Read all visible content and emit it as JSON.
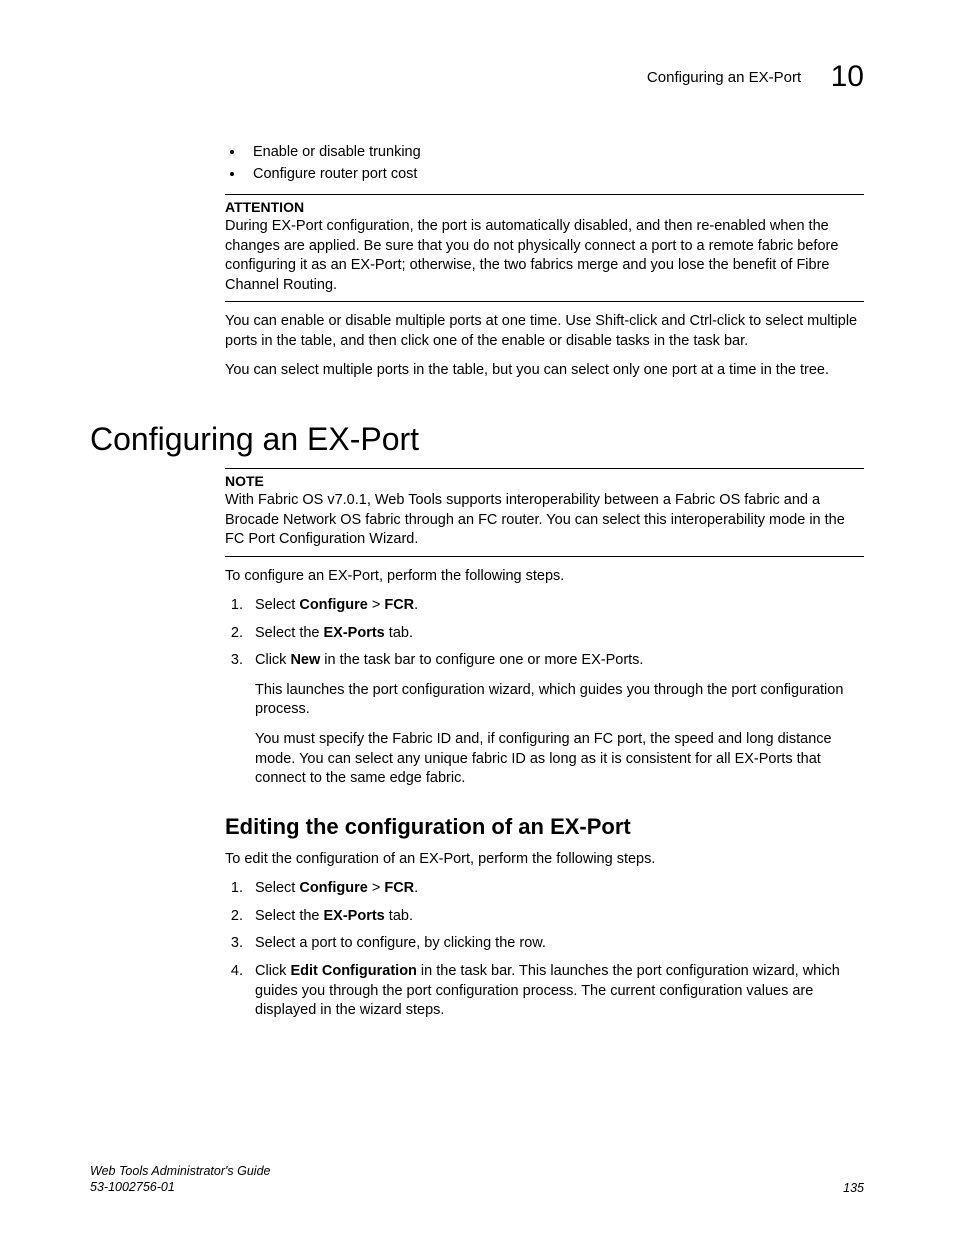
{
  "header": {
    "title": "Configuring an EX-Port",
    "chapter": "10"
  },
  "bullets": [
    "Enable or disable trunking",
    "Configure router port cost"
  ],
  "attention": {
    "label": "ATTENTION",
    "text": "During EX-Port configuration, the port is automatically disabled, and then re-enabled when the changes are applied. Be sure that you do not physically connect a port to a remote fabric before configuring it as an EX-Port; otherwise, the two fabrics merge and you lose the benefit of Fibre Channel Routing."
  },
  "para1": "You can enable or disable multiple ports at one time. Use Shift-click and Ctrl-click to select multiple ports in the table, and then click one of the enable or disable tasks in the task bar.",
  "para2": "You can select multiple ports in the table, but you can select only one port at a time in the tree.",
  "section_heading": "Configuring an EX-Port",
  "note": {
    "label": "NOTE",
    "text": "With Fabric OS v7.0.1, Web Tools supports interoperability between a Fabric OS fabric and a Brocade Network OS fabric through an FC router. You can select this interoperability mode in the FC Port Configuration Wizard."
  },
  "intro1": "To configure an EX-Port, perform the following steps.",
  "steps1": {
    "s1a": "Select ",
    "s1b": "Configure",
    "s1c": " > ",
    "s1d": "FCR",
    "s1e": ".",
    "s2a": "Select the ",
    "s2b": "EX-Ports",
    "s2c": " tab.",
    "s3a": "Click ",
    "s3b": "New",
    "s3c": " in the task bar to configure one or more EX-Ports.",
    "s3p1": "This launches the port configuration wizard, which guides you through the port configuration process.",
    "s3p2": "You must specify the Fabric ID and, if configuring an FC port, the speed and long distance mode. You can select any unique fabric ID as long as it is consistent for all EX-Ports that connect to the same edge fabric."
  },
  "subsection_heading": "Editing the configuration of an EX-Port",
  "intro2": "To edit the configuration of an EX-Port, perform the following steps.",
  "steps2": {
    "s1a": "Select ",
    "s1b": "Configure",
    "s1c": " > ",
    "s1d": "FCR",
    "s1e": ".",
    "s2a": "Select the ",
    "s2b": "EX-Ports",
    "s2c": " tab.",
    "s3": "Select a port to configure, by clicking the row.",
    "s4a": "Click ",
    "s4b": "Edit Configuration",
    "s4c": " in the task bar. This launches the port configuration wizard, which guides you through the port configuration process. The current configuration values are displayed in the wizard steps."
  },
  "footer": {
    "guide": "Web Tools Administrator's Guide",
    "docnum": "53-1002756-01",
    "page": "135"
  }
}
